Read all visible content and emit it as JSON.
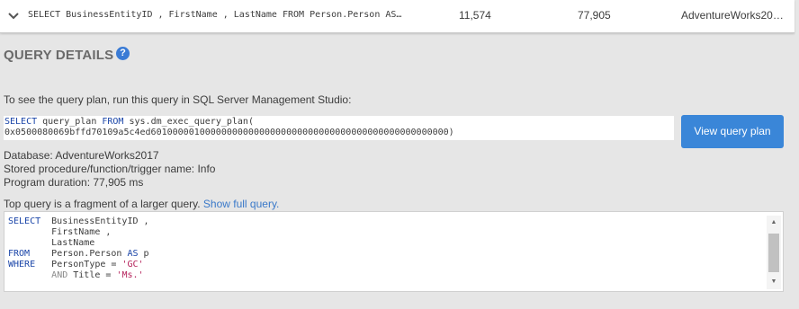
{
  "summary": {
    "sql": "SELECT BusinessEntityID , FirstName , LastName FROM Person.Person AS…",
    "value_1": "11,574",
    "value_2": "77,905",
    "database": "AdventureWorks20…"
  },
  "details": {
    "heading": "QUERY DETAILS",
    "help_glyph": "?",
    "intro": "To see the query plan, run this query in SQL Server Management Studio:",
    "plan_sql": {
      "kw_select": "SELECT",
      "col": " query_plan ",
      "kw_from": "FROM",
      "func": " sys.dm_exec_query_plan(",
      "handle": "0x0500080069bffd70109a5c4ed6010000010000000000000000000000000000000000000000000000)"
    },
    "view_plan_label": "View query plan",
    "database": "Database: AdventureWorks2017",
    "procedure": "Stored procedure/function/trigger name: Info",
    "duration": "Program duration: 77,905 ms",
    "fragment_text": "Top query is a fragment of a larger query.",
    "fragment_link": "Show full query."
  },
  "code": {
    "l1_kw": "SELECT",
    "l1_text": "  BusinessEntityID ,",
    "l2_text": "        FirstName ,",
    "l3_text": "        LastName",
    "l4_kw": "FROM",
    "l4_text": "    Person.Person ",
    "l4_kw2": "AS",
    "l4_text2": " p",
    "l5_kw": "WHERE",
    "l5_text": "   PersonType = ",
    "l5_str": "'GC'",
    "l6_pad": "        ",
    "l6_kw": "AND",
    "l6_text": " Title = ",
    "l6_str": "'Ms.'"
  },
  "colors": {
    "accent": "#3a86d8",
    "keyword": "#1a45a8",
    "string": "#b5245c",
    "link": "#3a79c9"
  }
}
